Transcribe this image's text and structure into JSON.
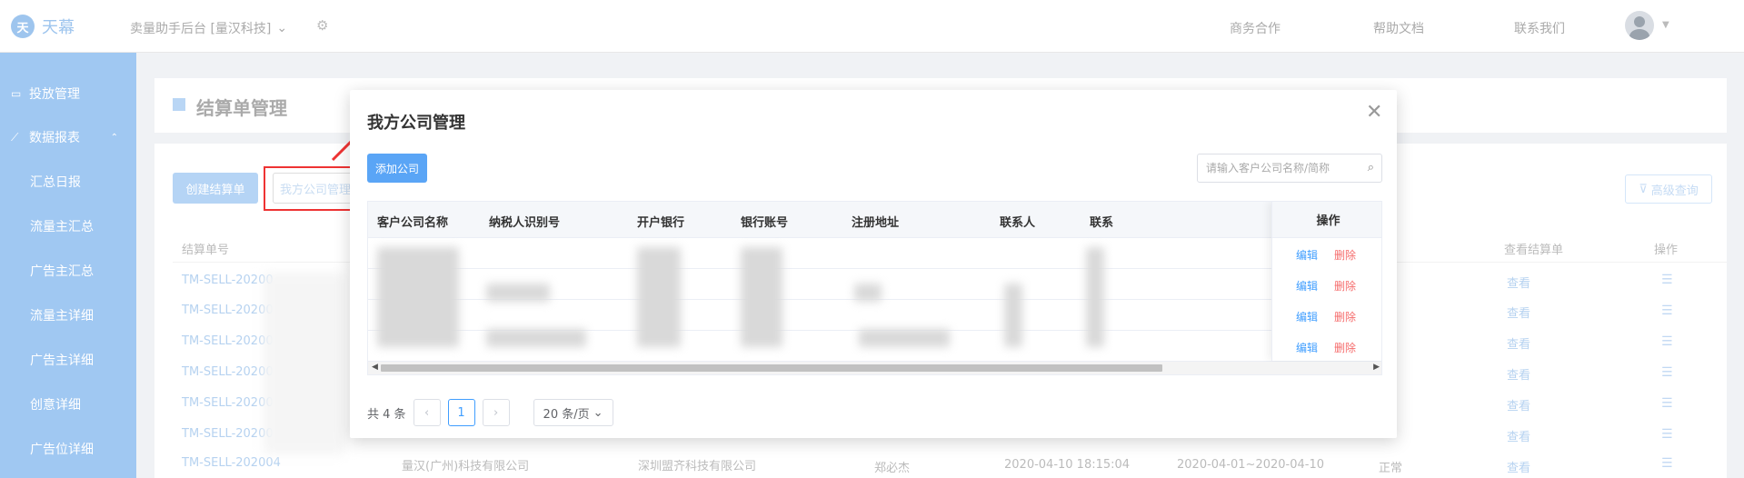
{
  "header": {
    "logo_mark": "天",
    "app_name": "天幕",
    "workspace": "卖量助手后台 [量汉科技]",
    "links": [
      "商务合作",
      "帮助文档",
      "联系我们"
    ]
  },
  "sidebar": {
    "items": [
      {
        "label": "投放管理",
        "icon": "inbox-icon"
      },
      {
        "label": "数据报表",
        "icon": "chart-icon"
      },
      {
        "label": "汇总日报"
      },
      {
        "label": "流量主汇总"
      },
      {
        "label": "广告主汇总"
      },
      {
        "label": "流量主详细"
      },
      {
        "label": "广告主详细"
      },
      {
        "label": "创意详细"
      },
      {
        "label": "广告位详细"
      }
    ]
  },
  "page": {
    "title": "结算单管理",
    "create_button": "创建结算单",
    "company_button": "我方公司管理",
    "advanced_query": "高级查询"
  },
  "background_table": {
    "headers": [
      "结算单号",
      "查看结算单",
      "操作"
    ],
    "rows": [
      {
        "id": "TM-SELL-20200",
        "view": "查看"
      },
      {
        "id": "TM-SELL-20200",
        "view": "查看"
      },
      {
        "id": "TM-SELL-20200",
        "view": "查看"
      },
      {
        "id": "TM-SELL-20200",
        "view": "查看"
      },
      {
        "id": "TM-SELL-20200",
        "view": "查看"
      },
      {
        "id": "TM-SELL-20200",
        "view": "查看"
      },
      {
        "id": "TM-SELL-202004",
        "company": "量汉(广州)科技有限公司",
        "partner": "深圳盟齐科技有限公司",
        "person": "郑必杰",
        "time": "2020-04-10 18:15:04",
        "period": "2020-04-01~2020-04-10",
        "status": "正常",
        "view": "查看"
      }
    ]
  },
  "modal": {
    "title": "我方公司管理",
    "add_button": "添加公司",
    "search_placeholder": "请输入客户公司名称/简称",
    "columns": [
      "客户公司名称",
      "纳税人识别号",
      "开户银行",
      "银行账号",
      "注册地址",
      "联系人",
      "联系"
    ],
    "action_column": "操作",
    "edit_label": "编辑",
    "delete_label": "删除",
    "row_count": 4,
    "pagination": {
      "total": "共 4 条",
      "current_page": "1",
      "page_size": "20 条/页"
    }
  }
}
